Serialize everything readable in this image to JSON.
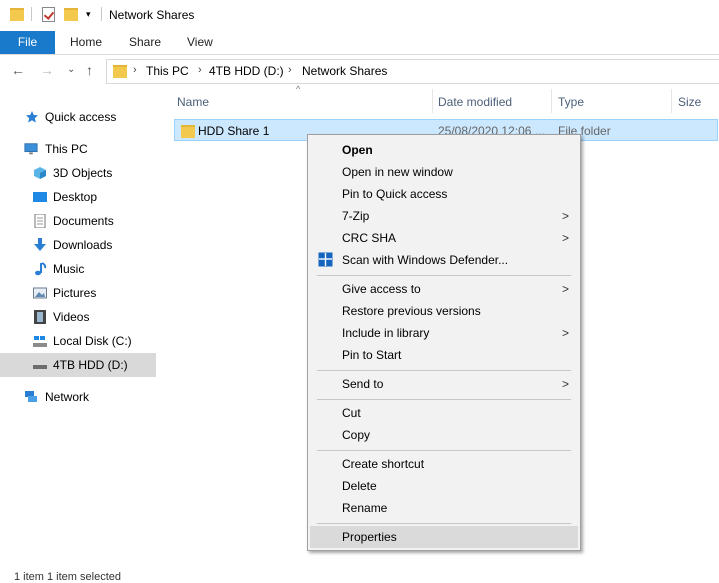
{
  "window": {
    "title": "Network Shares"
  },
  "ribbon": {
    "tabs": [
      "File",
      "Home",
      "Share",
      "View"
    ]
  },
  "address": {
    "crumbs": [
      "This PC",
      "4TB HDD (D:)",
      "Network Shares"
    ]
  },
  "nav": {
    "quick_access": "Quick access",
    "this_pc": "This PC",
    "items": [
      "3D Objects",
      "Desktop",
      "Documents",
      "Downloads",
      "Music",
      "Pictures",
      "Videos",
      "Local Disk (C:)",
      "4TB HDD (D:)"
    ],
    "network": "Network"
  },
  "columns": {
    "name": "Name",
    "date": "Date modified",
    "type": "Type",
    "size": "Size"
  },
  "file": {
    "name": "HDD Share 1",
    "date": "25/08/2020 12:06 ...",
    "type": "File folder"
  },
  "menu": {
    "open": "Open",
    "open_new": "Open in new window",
    "pin_quick": "Pin to Quick access",
    "zip": "7-Zip",
    "crc": "CRC SHA",
    "scan": "Scan with Windows Defender...",
    "give_access": "Give access to",
    "restore": "Restore previous versions",
    "include": "Include in library",
    "pin_start": "Pin to Start",
    "send_to": "Send to",
    "cut": "Cut",
    "copy": "Copy",
    "create_shortcut": "Create shortcut",
    "delete": "Delete",
    "rename": "Rename",
    "properties": "Properties"
  },
  "status": {
    "text": "1 item     1 item selected"
  },
  "colors": {
    "accent": "#1979ca",
    "selection": "#cce8ff",
    "folder": "#f2c94c"
  }
}
